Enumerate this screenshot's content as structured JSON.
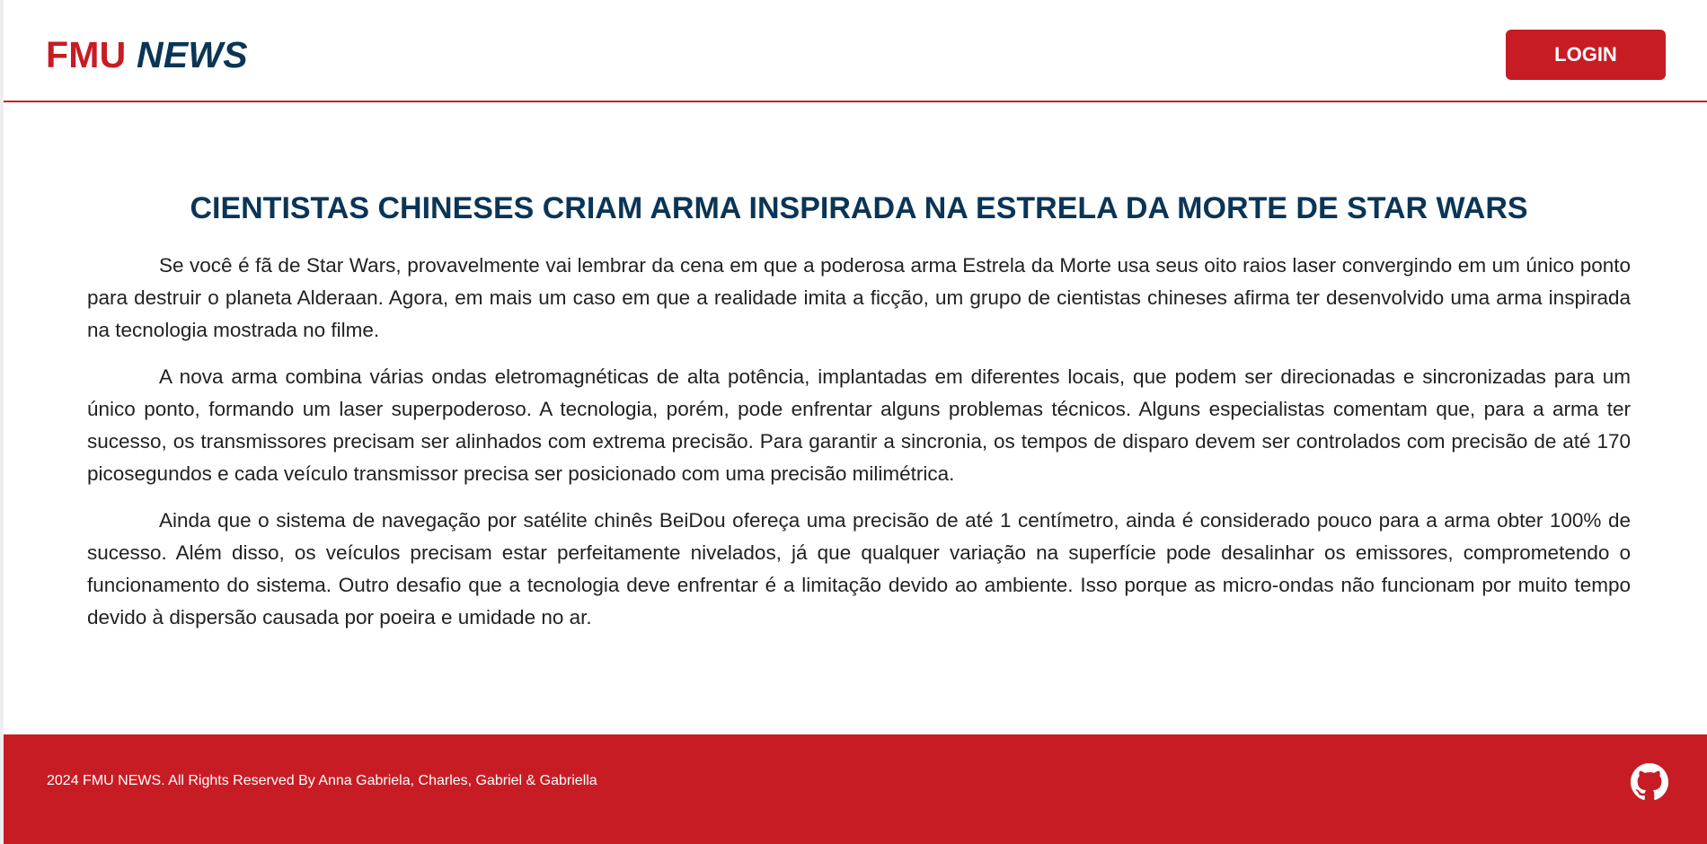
{
  "header": {
    "logo_part1": "FMU",
    "logo_part2": "NEWS",
    "login_label": "LOGIN"
  },
  "article": {
    "title": "CIENTISTAS CHINESES CRIAM ARMA INSPIRADA NA ESTRELA DA MORTE DE STAR WARS",
    "paragraphs": [
      "Se você é fã de Star Wars, provavelmente vai lembrar da cena em que a poderosa arma Estrela da Morte usa seus oito raios laser convergindo em um único ponto para destruir o planeta Alderaan. Agora, em mais um caso em que a realidade imita a ficção, um grupo de cientistas chineses afirma ter desenvolvido uma arma inspirada na tecnologia mostrada no filme.",
      "A nova arma combina várias ondas eletromagnéticas de alta potência, implantadas em diferentes locais, que podem ser direcionadas e sincronizadas para um único ponto, formando um laser superpoderoso. A tecnologia, porém, pode enfrentar alguns problemas técnicos. Alguns especialistas comentam que, para a arma ter sucesso, os transmissores precisam ser alinhados com extrema precisão. Para garantir a sincronia, os tempos de disparo devem ser controlados com precisão de até 170 picosegundos e cada veículo transmissor precisa ser posicionado com uma precisão milimétrica.",
      "Ainda que o sistema de navegação por satélite chinês BeiDou ofereça uma precisão de até 1 centímetro, ainda é considerado pouco para a arma obter 100% de sucesso. Além disso, os veículos precisam estar perfeitamente nivelados, já que qualquer variação na superfície pode desalinhar os emissores, comprometendo o funcionamento do sistema. Outro desafio que a tecnologia deve enfrentar é a limitação devido ao ambiente. Isso porque as micro-ondas não funcionam por muito tempo devido à dispersão causada por poeira e umidade no ar."
    ]
  },
  "footer": {
    "copyright": "2024 FMU NEWS. All Rights Reserved By Anna Gabriela, Charles, Gabriel & Gabriella",
    "github_icon": "github-icon"
  },
  "colors": {
    "brand_red": "#c81c24",
    "brand_navy": "#0a3556"
  }
}
